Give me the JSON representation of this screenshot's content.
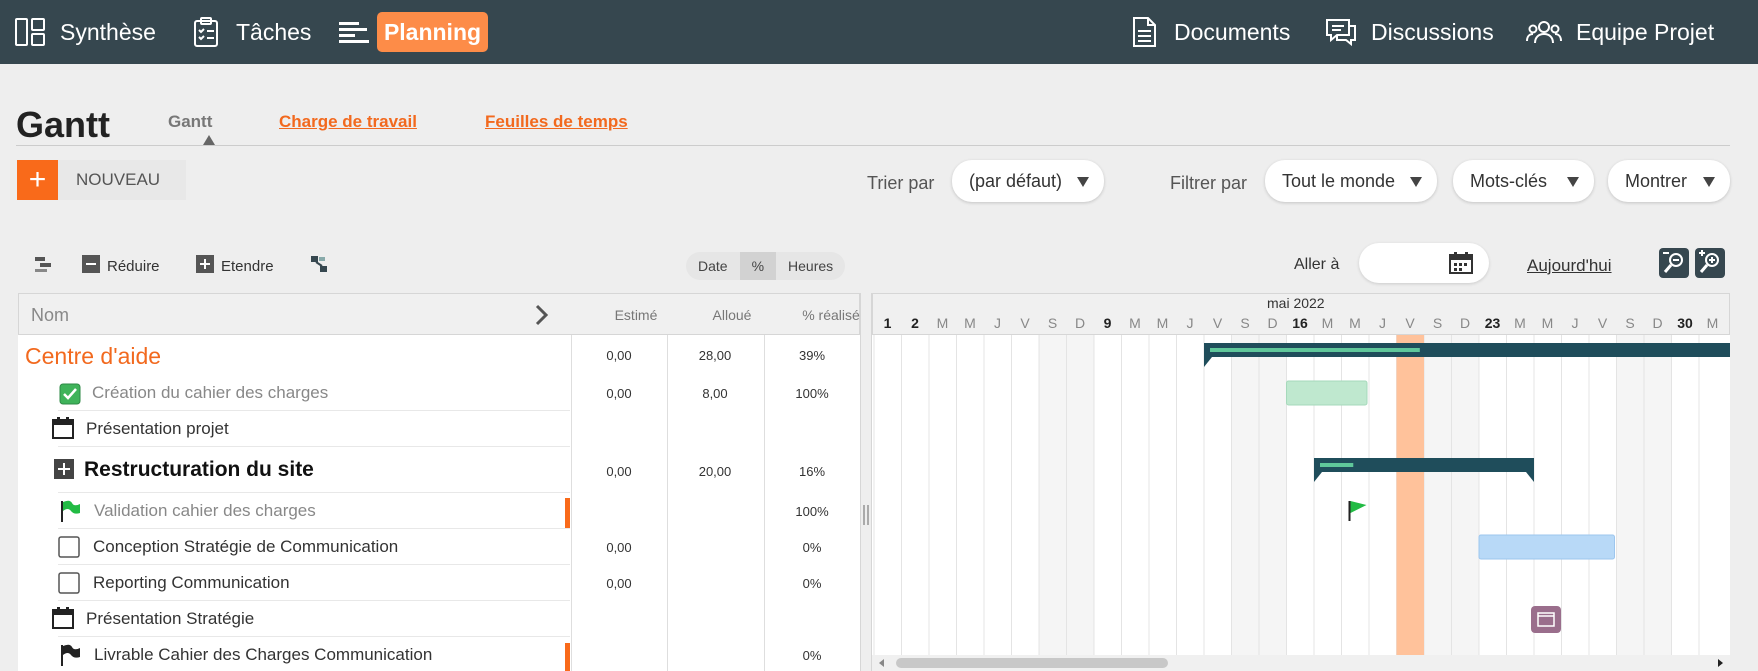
{
  "nav": {
    "left": [
      {
        "label": "Synthèse",
        "icon": "dashboard-icon"
      },
      {
        "label": "Tâches",
        "icon": "clipboard-checklist-icon"
      },
      {
        "label": "Planning",
        "icon": "gantt-lines-icon"
      }
    ],
    "right": [
      {
        "label": "Documents",
        "icon": "document-icon"
      },
      {
        "label": "Discussions",
        "icon": "chat-bubbles-icon"
      },
      {
        "label": "Equipe Projet",
        "icon": "team-icon"
      }
    ]
  },
  "header": {
    "title": "Gantt",
    "active_tab": "Gantt",
    "tab_workload": "Charge de travail",
    "tab_timesheets": "Feuilles de temps"
  },
  "actions": {
    "new_icon": "+",
    "new_label": "NOUVEAU",
    "sort_label": "Trier par",
    "sort_value": "(par défaut)",
    "filter_label": "Filtrer par",
    "filter_people": "Tout le monde",
    "filter_keywords": "Mots-clés",
    "filter_show": "Montrer"
  },
  "toolbar": {
    "reduce": "Réduire",
    "expand": "Etendre",
    "mode_date": "Date",
    "mode_percent": "%",
    "mode_hours": "Heures",
    "goto_label": "Aller à",
    "goto_value": "",
    "today": "Aujourd'hui"
  },
  "grid": {
    "col_name": "Nom",
    "col_estimated": "Estimé",
    "col_allocated": "Alloué",
    "col_done": "% réalisé",
    "rows": [
      {
        "name": "Centre d'aide",
        "estimated": "0,00",
        "allocated": "28,00",
        "done": "39%"
      },
      {
        "name": "Création du cahier des charges",
        "estimated": "0,00",
        "allocated": "8,00",
        "done": "100%"
      },
      {
        "name": "Présentation projet",
        "estimated": "",
        "allocated": "",
        "done": ""
      },
      {
        "name": "Restructuration du site",
        "estimated": "0,00",
        "allocated": "20,00",
        "done": "16%"
      },
      {
        "name": "Validation cahier des charges",
        "estimated": "",
        "allocated": "",
        "done": "100%"
      },
      {
        "name": "Conception Stratégie de Communication",
        "estimated": "0,00",
        "allocated": "",
        "done": "0%"
      },
      {
        "name": "Reporting Communication",
        "estimated": "0,00",
        "allocated": "",
        "done": "0%"
      },
      {
        "name": "Présentation Stratégie",
        "estimated": "",
        "allocated": "",
        "done": ""
      },
      {
        "name": "Livrable Cahier des Charges Communication",
        "estimated": "",
        "allocated": "",
        "done": "0%"
      }
    ]
  },
  "timeline": {
    "month": "mai 2022",
    "days": [
      "1",
      "2",
      "M",
      "M",
      "J",
      "V",
      "S",
      "D",
      "9",
      "M",
      "M",
      "J",
      "V",
      "S",
      "D",
      "16",
      "M",
      "M",
      "J",
      "V",
      "S",
      "D",
      "23",
      "M",
      "M",
      "J",
      "V",
      "S",
      "D",
      "30",
      "M"
    ],
    "bold_days": [
      "1",
      "2",
      "9",
      "16",
      "23",
      "30"
    ],
    "today_day": "20",
    "first_day": 1,
    "tasks": [
      {
        "type": "summary",
        "start": 13.0,
        "end": 33.0,
        "progress": 0.39
      },
      {
        "type": "bar-done",
        "start": 16.0,
        "end": 19.0,
        "color": "#bfe8cf"
      },
      {
        "type": "summary",
        "start": 17.0,
        "end": 25.0,
        "progress": 0.16
      },
      {
        "type": "milestone",
        "day": 18.0
      },
      {
        "type": "bar",
        "start": 23.0,
        "end": 28.0,
        "color": "#b8d9f7"
      },
      {
        "type": "meeting",
        "day": 25.0
      }
    ]
  },
  "colors": {
    "nav_bg": "#36474f",
    "accent": "#f96a1a",
    "summary_bar": "#1f4d5b",
    "today": "#ffc29b",
    "weekend": "#f5f5f5"
  }
}
